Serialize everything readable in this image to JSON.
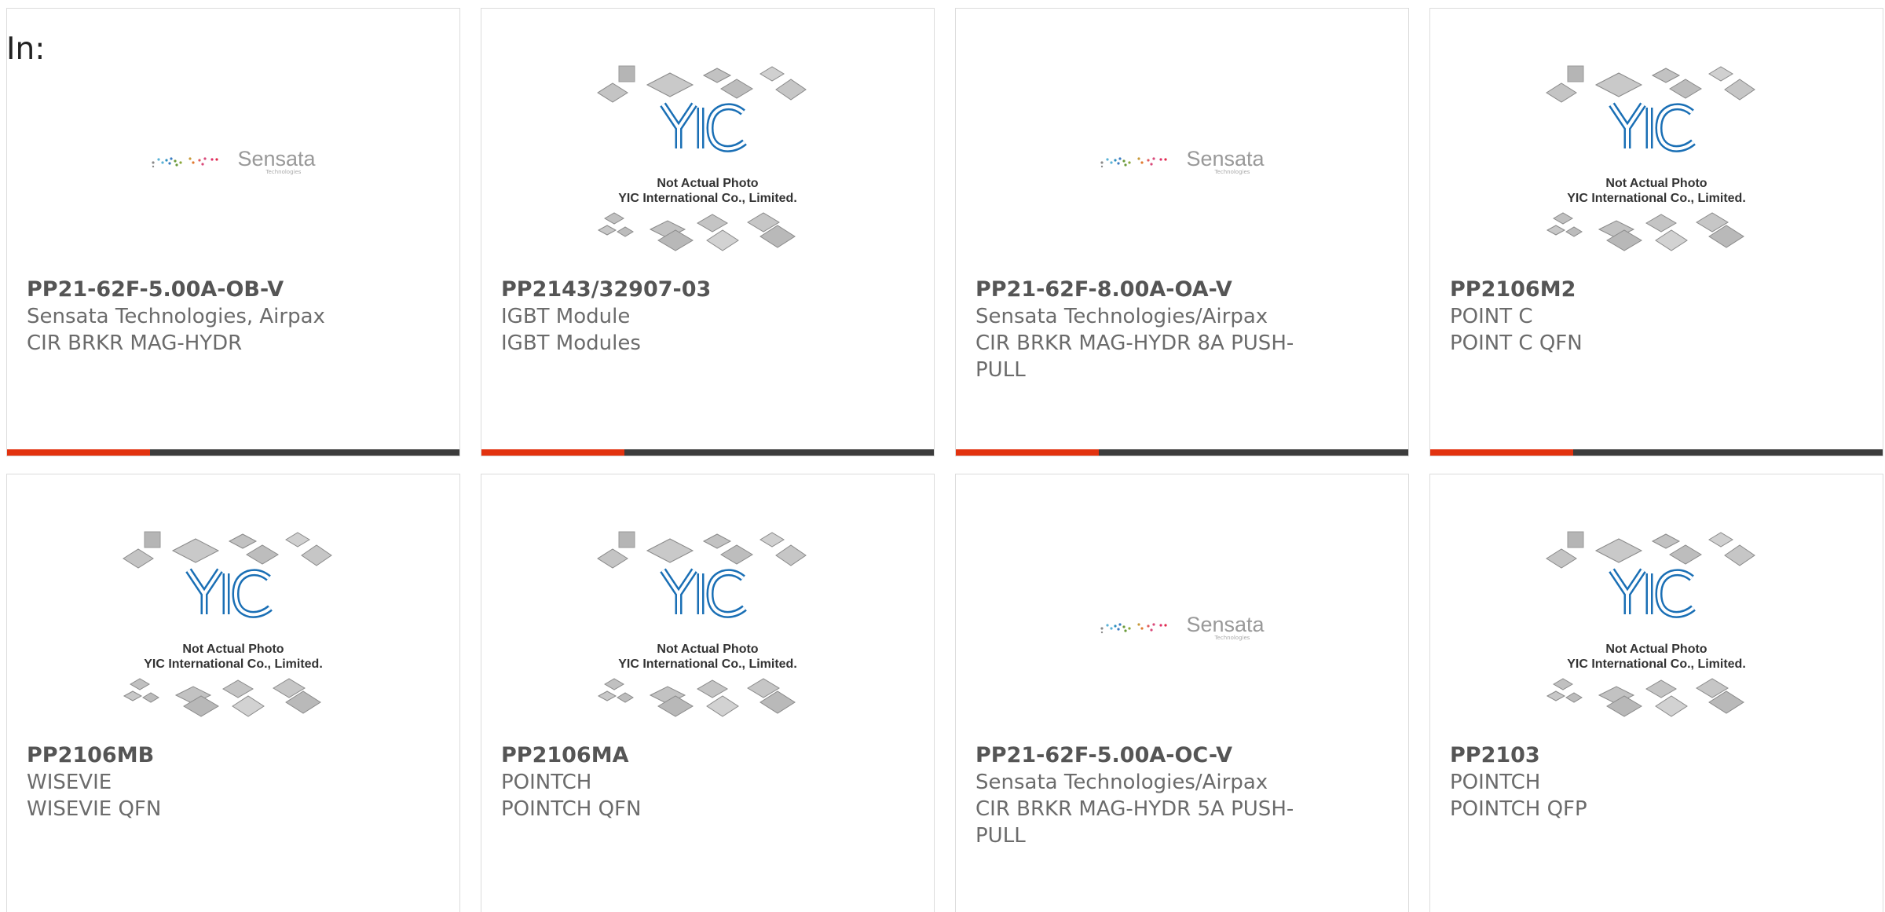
{
  "header": {
    "label": "In:"
  },
  "products": [
    {
      "part_number": "PP21-62F-5.00A-OB-V",
      "manufacturer": "Sensata Technologies, Airpax",
      "description": "CIR BRKR MAG-HYDR",
      "image": {
        "type": "sensata-logo",
        "brand": "Sensata",
        "tagline": "Technologies"
      }
    },
    {
      "part_number": "PP2143/32907-03",
      "manufacturer": "IGBT Module",
      "description": "IGBT Modules",
      "image": {
        "type": "placeholder",
        "logo": "YIC",
        "line1": "Not Actual Photo",
        "line2": "YIC International Co., Limited."
      }
    },
    {
      "part_number": "PP21-62F-8.00A-OA-V",
      "manufacturer": "Sensata Technologies/Airpax",
      "description": "CIR BRKR MAG-HYDR 8A PUSH-PULL",
      "image": {
        "type": "sensata-logo",
        "brand": "Sensata",
        "tagline": "Technologies"
      }
    },
    {
      "part_number": "PP2106M2",
      "manufacturer": "POINT C",
      "description": "POINT C QFN",
      "image": {
        "type": "placeholder",
        "logo": "YIC",
        "line1": "Not Actual Photo",
        "line2": "YIC International Co., Limited."
      }
    },
    {
      "part_number": "PP2106MB",
      "manufacturer": "WISEVIE",
      "description": "WISEVIE QFN",
      "image": {
        "type": "placeholder",
        "logo": "YIC",
        "line1": "Not Actual Photo",
        "line2": "YIC International Co., Limited."
      }
    },
    {
      "part_number": "PP2106MA",
      "manufacturer": "POINTCH",
      "description": "POINTCH QFN",
      "image": {
        "type": "placeholder",
        "logo": "YIC",
        "line1": "Not Actual Photo",
        "line2": "YIC International Co., Limited."
      }
    },
    {
      "part_number": "PP21-62F-5.00A-OC-V",
      "manufacturer": "Sensata Technologies/Airpax",
      "description": "CIR BRKR MAG-HYDR 5A PUSH-PULL",
      "image": {
        "type": "sensata-logo",
        "brand": "Sensata",
        "tagline": "Technologies"
      }
    },
    {
      "part_number": "PP2103",
      "manufacturer": "POINTCH",
      "description": "POINTCH QFP",
      "image": {
        "type": "placeholder",
        "logo": "YIC",
        "line1": "Not Actual Photo",
        "line2": "YIC International Co., Limited."
      }
    }
  ],
  "colors": {
    "accent_bar": "#e2320f",
    "dark_bar": "#3c3c3c",
    "yic_blue": "#1a6fb5"
  }
}
